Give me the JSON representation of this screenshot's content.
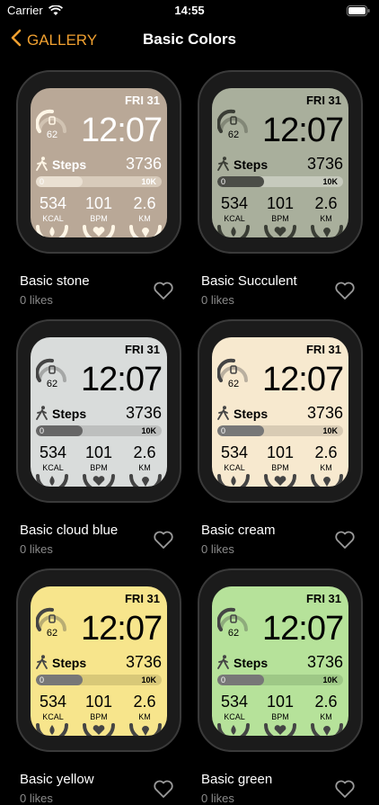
{
  "status": {
    "carrier": "Carrier",
    "time": "14:55"
  },
  "nav": {
    "back_label": "GALLERY",
    "title": "Basic Colors"
  },
  "faces": [
    {
      "name": "Basic stone",
      "likes": "0 likes",
      "bg": "#b9a897",
      "text_color": "#ffffff",
      "ring": "#fff6e6",
      "bar_bg": "#d8cbbb",
      "bar_fill": "#eae0d2"
    },
    {
      "name": "Basic Succulent",
      "likes": "0 likes",
      "bg": "#a9af9c",
      "text_color": "#000000",
      "ring": "#3a3d35",
      "bar_bg": "#c6cabd",
      "bar_fill": "#4b4d47"
    },
    {
      "name": "Basic cloud blue",
      "likes": "0 likes",
      "bg": "#d9dcdb",
      "text_color": "#000000",
      "ring": "#444",
      "bar_bg": "#bdbfbe",
      "bar_fill": "#666"
    },
    {
      "name": "Basic cream",
      "likes": "0 likes",
      "bg": "#f7e9cf",
      "text_color": "#000000",
      "ring": "#444",
      "bar_bg": "#d8cbb4",
      "bar_fill": "#777"
    },
    {
      "name": "Basic yellow",
      "likes": "0 likes",
      "bg": "#f7e58c",
      "text_color": "#000000",
      "ring": "#444",
      "bar_bg": "#d8c878",
      "bar_fill": "#777"
    },
    {
      "name": "Basic green",
      "likes": "0 likes",
      "bg": "#b6e29a",
      "text_color": "#000000",
      "ring": "#444",
      "bar_bg": "#9ec886",
      "bar_fill": "#777"
    }
  ],
  "watch": {
    "date": "FRI 31",
    "time": "12:07",
    "ring_value": "62",
    "steps_label": "Steps",
    "steps_value": "3736",
    "bar_min": "0",
    "bar_max": "10K",
    "bar_progress": 0.37,
    "kcal_value": "534",
    "kcal_label": "KCAL",
    "bpm_value": "101",
    "bpm_label": "BPM",
    "km_value": "2.6",
    "km_label": "KM"
  },
  "colors": {
    "accent": "#f0a030",
    "muted": "#8a8a8a"
  }
}
